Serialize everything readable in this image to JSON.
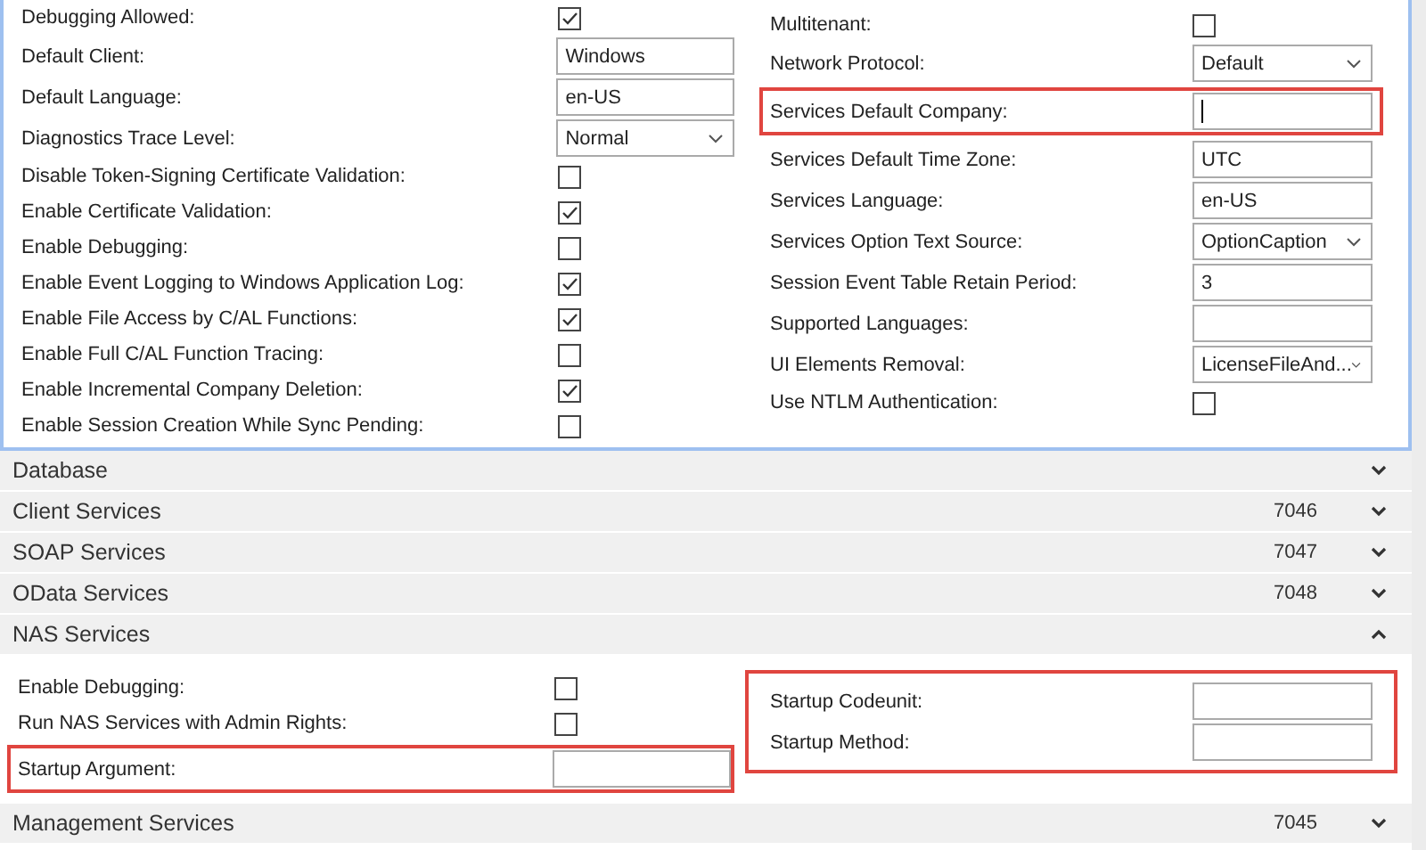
{
  "panel": {
    "columns": [
      {
        "groups": [
          {
            "highlighted": false,
            "fields": [
              {
                "kind": "checkbox",
                "label": "Debugging Allowed:",
                "checked": true
              },
              {
                "kind": "text",
                "label": "Default Client:",
                "value": "Windows"
              },
              {
                "kind": "text",
                "label": "Default Language:",
                "value": "en-US"
              },
              {
                "kind": "dropdown",
                "label": "Diagnostics Trace Level:",
                "value": "Normal"
              },
              {
                "kind": "checkbox",
                "label": "Disable Token-Signing Certificate Validation:",
                "checked": false
              },
              {
                "kind": "checkbox",
                "label": "Enable Certificate Validation:",
                "checked": true
              },
              {
                "kind": "checkbox",
                "label": "Enable Debugging:",
                "checked": false
              },
              {
                "kind": "checkbox",
                "label": "Enable Event Logging to Windows Application Log:",
                "checked": true
              },
              {
                "kind": "checkbox",
                "label": "Enable File Access by C/AL Functions:",
                "checked": true
              },
              {
                "kind": "checkbox",
                "label": "Enable Full C/AL Function Tracing:",
                "checked": false
              },
              {
                "kind": "checkbox",
                "label": "Enable Incremental Company Deletion:",
                "checked": true
              },
              {
                "kind": "checkbox",
                "label": "Enable Session Creation While Sync Pending:",
                "checked": false
              }
            ]
          }
        ]
      },
      {
        "groups": [
          {
            "highlighted": false,
            "fields": [
              {
                "kind": "checkbox",
                "label": "Multitenant:",
                "checked": false
              },
              {
                "kind": "dropdown",
                "label": "Network Protocol:",
                "value": "Default"
              }
            ]
          },
          {
            "highlighted": true,
            "fields": [
              {
                "kind": "text",
                "label": "Services Default Company:",
                "focused": true
              }
            ]
          },
          {
            "highlighted": false,
            "fields": [
              {
                "kind": "text",
                "label": "Services Default Time Zone:",
                "value": "UTC"
              },
              {
                "kind": "text",
                "label": "Services Language:",
                "value": "en-US"
              },
              {
                "kind": "dropdown",
                "label": "Services Option Text Source:",
                "value": "OptionCaption"
              },
              {
                "kind": "text",
                "label": "Session Event Table Retain Period:",
                "value": "3"
              },
              {
                "kind": "text",
                "label": "Supported Languages:"
              },
              {
                "kind": "dropdown",
                "label": "UI Elements Removal:",
                "value": "LicenseFileAnd..."
              },
              {
                "kind": "checkbox",
                "label": "Use NTLM Authentication:",
                "checked": false
              }
            ]
          }
        ]
      }
    ]
  },
  "sections": [
    {
      "title": "Database",
      "expanded": false
    },
    {
      "title": "Client Services",
      "port": "7046",
      "expanded": false
    },
    {
      "title": "SOAP Services",
      "port": "7047",
      "expanded": false
    },
    {
      "title": "OData Services",
      "port": "7048",
      "expanded": false
    },
    {
      "title": "NAS Services",
      "expanded": true,
      "columns": [
        {
          "groups": [
            {
              "highlighted": false,
              "fields": [
                {
                  "kind": "checkbox",
                  "label": "Enable Debugging:",
                  "checked": false
                },
                {
                  "kind": "checkbox",
                  "label": "Run NAS Services with Admin Rights:",
                  "checked": false
                }
              ]
            },
            {
              "highlighted": true,
              "fields": [
                {
                  "kind": "text",
                  "label": "Startup Argument:"
                }
              ]
            }
          ]
        },
        {
          "groups": [
            {
              "highlighted": true,
              "fields": [
                {
                  "kind": "text",
                  "label": "Startup Codeunit:"
                },
                {
                  "kind": "text",
                  "label": "Startup Method:"
                }
              ]
            }
          ]
        }
      ]
    },
    {
      "title": "Management Services",
      "port": "7045",
      "expanded": false
    }
  ]
}
